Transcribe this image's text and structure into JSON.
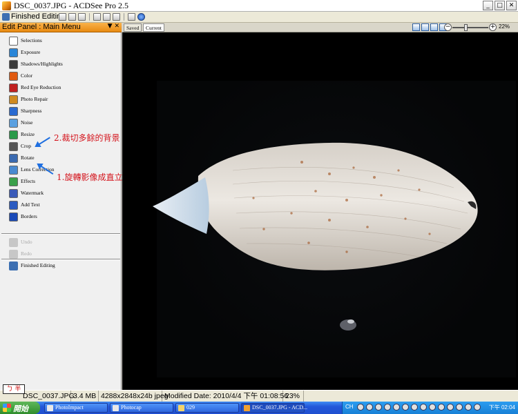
{
  "window": {
    "title": "DSC_0037.JPG - ACDSee Pro 2.5",
    "controls": [
      "_",
      "□",
      "✕"
    ]
  },
  "toolbar": {
    "finished_editing": "Finished Editing"
  },
  "panel": {
    "title": "Edit Panel : Main Menu",
    "controls": "▼ ✕",
    "items": [
      {
        "label": "Selections",
        "icon": "selections-icon",
        "color": "#ffffff"
      },
      {
        "label": "Exposure",
        "icon": "exposure-icon",
        "color": "#2a86d8"
      },
      {
        "label": "Shadows/Highlights",
        "icon": "shadows-highlights-icon",
        "color": "#3a3a3a"
      },
      {
        "label": "Color",
        "icon": "color-icon",
        "color": "#e05a10"
      },
      {
        "label": "Red Eye Reduction",
        "icon": "red-eye-icon",
        "color": "#c02020"
      },
      {
        "label": "Photo Repair",
        "icon": "photo-repair-icon",
        "color": "#d08a20"
      },
      {
        "label": "Sharpness",
        "icon": "sharpness-icon",
        "color": "#2a6ad0"
      },
      {
        "label": "Noise",
        "icon": "noise-icon",
        "color": "#5aa0e0"
      },
      {
        "label": "Resize",
        "icon": "resize-icon",
        "color": "#2a9a4a"
      },
      {
        "label": "Crop",
        "icon": "crop-icon",
        "color": "#555555"
      },
      {
        "label": "Rotate",
        "icon": "rotate-icon",
        "color": "#3a6ab0"
      },
      {
        "label": "Lens Correction",
        "icon": "lens-correction-icon",
        "color": "#4a8ad0"
      },
      {
        "label": "Effects",
        "icon": "effects-icon",
        "color": "#3aa04a"
      },
      {
        "label": "Watermark",
        "icon": "watermark-icon",
        "color": "#3a5ab8"
      },
      {
        "label": "Add Text",
        "icon": "add-text-icon",
        "color": "#2a5ac0"
      },
      {
        "label": "Borders",
        "icon": "borders-icon",
        "color": "#1a4ab8"
      }
    ],
    "undo": "Undo",
    "redo": "Redo",
    "finished_editing": "Finished Editing"
  },
  "annotations": {
    "crop_note": "2.裁切多餘的背景",
    "rotate_note": "1.旋轉影像成直立",
    "arrow_color": "#1f6fe0",
    "text_color": "#d4141c"
  },
  "view": {
    "tabs": [
      "Saved",
      "Current"
    ],
    "active_tab": "Current",
    "zoom": "22%"
  },
  "status": {
    "ime": "ㄅ 半",
    "filename": "DSC_0037.JPG",
    "size": "3.4 MB",
    "dimensions": "4288x2848x24b jpeg",
    "modified": "Modified Date: 2010/4/4 下午 01:08:56",
    "zoom": "23%"
  },
  "taskbar": {
    "start": "開始",
    "tasks": [
      {
        "label": "PhotoImpact",
        "active": false
      },
      {
        "label": "Photocap",
        "active": false
      },
      {
        "label": "029",
        "active": false
      },
      {
        "label": "DSC_0037.JPG - ACD...",
        "active": true
      }
    ],
    "lang": "CH",
    "clock": "下午 02:04"
  }
}
